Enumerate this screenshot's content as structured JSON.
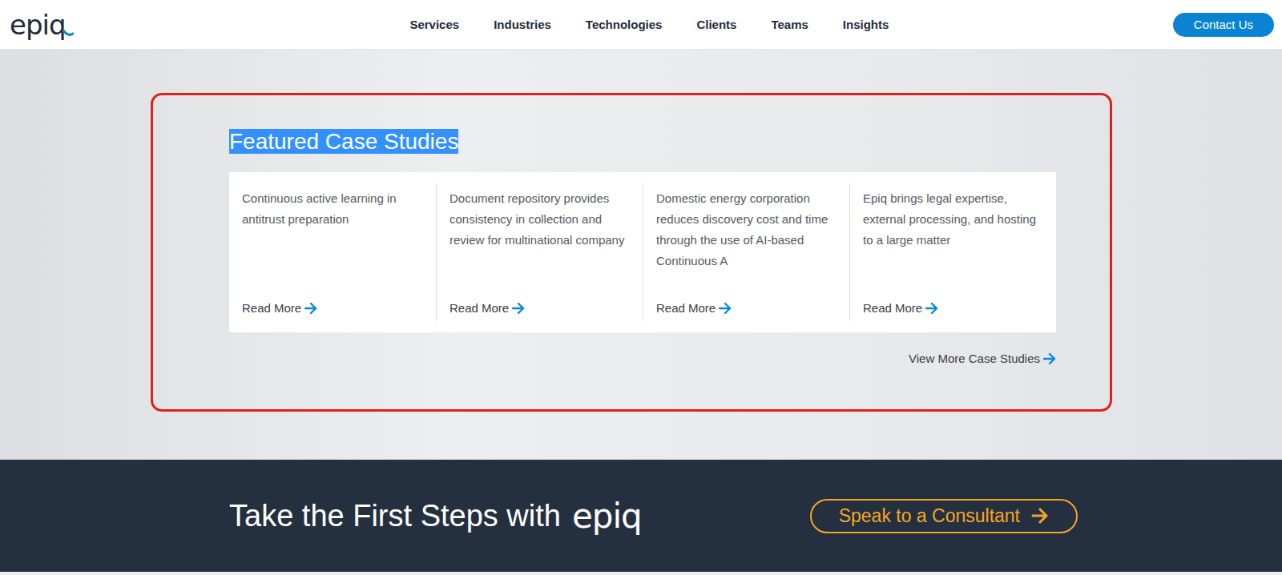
{
  "header": {
    "logo": "epiq",
    "nav": [
      "Services",
      "Industries",
      "Technologies",
      "Clients",
      "Teams",
      "Insights"
    ],
    "contact_button": "Contact Us"
  },
  "featured": {
    "title": "Featured Case Studies",
    "title_selected": true,
    "annotated": true,
    "cases": [
      {
        "summary": "Continuous active learning in antitrust preparation",
        "link": "Read More"
      },
      {
        "summary": "Document repository provides consistency in collection and review for multinational company",
        "link": "Read More"
      },
      {
        "summary": "Domestic energy corporation reduces discovery cost and time through the use of AI-based Continuous A",
        "link": "Read More"
      },
      {
        "summary": "Epiq brings legal expertise, external processing, and hosting to a large matter",
        "link": "Read More"
      }
    ],
    "view_more": "View More Case Studies"
  },
  "cta": {
    "heading": "Take the First Steps with",
    "logo": "epiq",
    "button": "Speak to a Consultant"
  }
}
